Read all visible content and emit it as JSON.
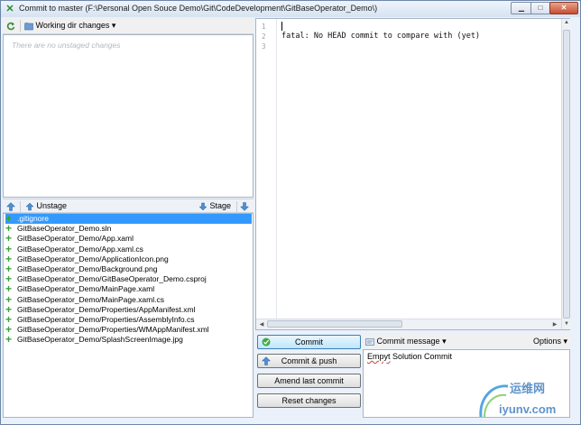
{
  "window": {
    "title": "Commit to master (F:\\Personal Open Souce Demo\\Git\\CodeDevelopment\\GitBaseOperator_Demo\\)",
    "min_glyph": "▁",
    "max_glyph": "□",
    "close_glyph": "✕"
  },
  "unstaged": {
    "dropdown_label": "Working dir changes",
    "dropdown_arrow": "▾",
    "empty_text": "There are no unstaged changes"
  },
  "stage_bar": {
    "unstage_label": "Unstage",
    "stage_label": "Stage"
  },
  "staged_files": [
    ".gitignore",
    "GitBaseOperator_Demo.sln",
    "GitBaseOperator_Demo/App.xaml",
    "GitBaseOperator_Demo/App.xaml.cs",
    "GitBaseOperator_Demo/ApplicationIcon.png",
    "GitBaseOperator_Demo/Background.png",
    "GitBaseOperator_Demo/GitBaseOperator_Demo.csproj",
    "GitBaseOperator_Demo/MainPage.xaml",
    "GitBaseOperator_Demo/MainPage.xaml.cs",
    "GitBaseOperator_Demo/Properties/AppManifest.xml",
    "GitBaseOperator_Demo/Properties/AssemblyInfo.cs",
    "GitBaseOperator_Demo/Properties/WMAppManifest.xml",
    "GitBaseOperator_Demo/SplashScreenImage.jpg"
  ],
  "diff": {
    "line_numbers": [
      "1",
      "2",
      "3"
    ],
    "text": "fatal: No HEAD commit to compare with (yet)"
  },
  "actions": {
    "commit": "Commit",
    "commit_push": "Commit & push",
    "amend": "Amend last commit",
    "reset": "Reset changes"
  },
  "commit_message": {
    "header_label": "Commit message",
    "options_label": "Options",
    "text_word1": "Empyt",
    "text_rest": " Solution Commit"
  },
  "watermark": {
    "chinese": "运维网",
    "domain": "iyunv.com"
  },
  "colors": {
    "selection": "#3399ff",
    "added_plus": "#3ca03c",
    "frame_border": "#6d86a8",
    "spell_underline": "#d23c3c"
  },
  "icons": [
    "app-icon",
    "refresh-icon",
    "folder-icon",
    "unstage-all-icon",
    "unstage-icon",
    "stage-icon",
    "stage-all-icon",
    "added-file-icon",
    "commit-check-icon",
    "push-icon",
    "message-icon"
  ]
}
